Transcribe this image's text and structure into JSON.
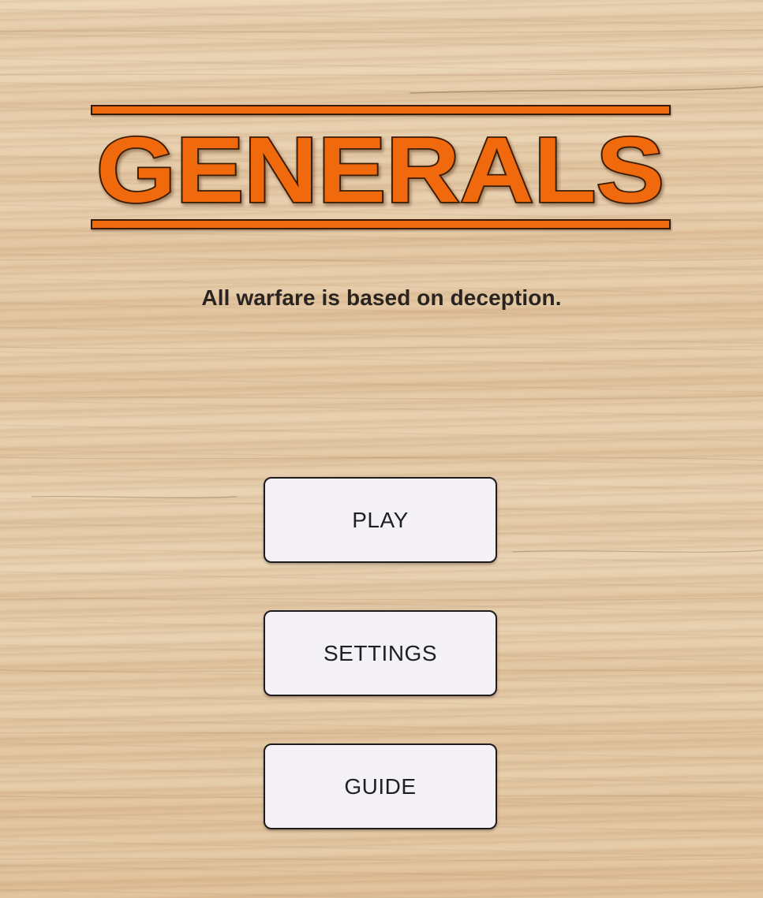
{
  "game": {
    "logo_text": "GENERALS",
    "tagline": "All warfare is based on deception.",
    "accent_color": "#f06a10",
    "outline_color": "#3a1a06"
  },
  "menu": {
    "play_label": "PLAY",
    "settings_label": "SETTINGS",
    "guide_label": "GUIDE"
  },
  "background": {
    "texture": "light wood grain",
    "base_color": "#e8d2b2"
  }
}
